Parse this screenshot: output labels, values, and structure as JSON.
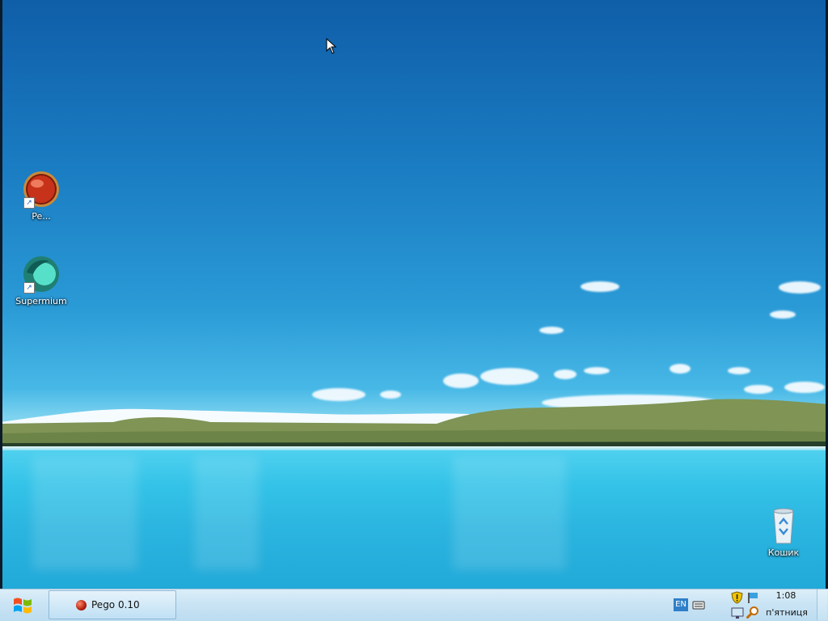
{
  "desktop": {
    "icons": [
      {
        "label": "Pe...",
        "icon": "pego-app-icon"
      },
      {
        "label": "Supermium",
        "icon": "supermium-browser-icon"
      },
      {
        "label": "Кошик",
        "icon": "recycle-bin-icon"
      }
    ]
  },
  "taskbar": {
    "start_icon": "windows-logo-icon",
    "tasks": [
      {
        "label": "Pego 0.10",
        "icon": "pego-app-icon"
      }
    ],
    "tray": {
      "language": "EN",
      "icons": [
        "keyboard-icon",
        "security-shield-icon",
        "action-center-flag-icon",
        "network-monitor-icon",
        "search-icon"
      ],
      "time": "1:08",
      "day": "п'ятниця"
    }
  },
  "colors": {
    "sky_top": "#0f5ea8",
    "lake": "#34c3e8",
    "taskbar": "#c8e3f4",
    "hills": "#7f9455"
  }
}
